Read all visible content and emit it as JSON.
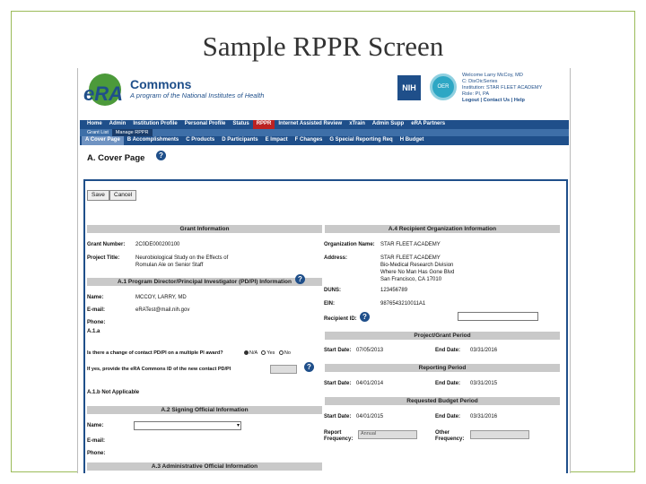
{
  "slide": {
    "title": "Sample RPPR Screen"
  },
  "header": {
    "logo_text": "eRA",
    "commons": "Commons",
    "program": "A program of the National Institutes of Health",
    "nih_logo": "NIH",
    "oer_logo": "OER",
    "user_lines": [
      "Welcome Larry McCoy, MD",
      "C: DisOicSeries",
      "Institution: STAR FLEET ACADEMY",
      "Role: PI, PA"
    ],
    "links": "Logout | Contact Us | Help"
  },
  "nav_main": [
    "Home",
    "Admin",
    "Institution Profile",
    "Personal Profile",
    "Status",
    "RPPR",
    "Internet Assisted Review",
    "xTrain",
    "Admin Supp",
    "eRA Partners"
  ],
  "nav_sub": [
    "Grant List",
    "Manage RPPR"
  ],
  "nav_sections": [
    "A Cover Page",
    "B Accomplishments",
    "C Products",
    "D Participants",
    "E Impact",
    "F Changes",
    "G Special Reporting Req",
    "H Budget"
  ],
  "page": {
    "title": "A. Cover Page"
  },
  "buttons": {
    "save": "Save",
    "cancel": "Cancel"
  },
  "grant_info": {
    "header": "Grant Information",
    "grant_number_label": "Grant Number:",
    "grant_number": "2C0DE000200100",
    "project_title_label": "Project Title:",
    "project_title_lines": [
      "Neurobiological Study on the Effects of",
      "Romulan Ale on Senior Staff"
    ]
  },
  "pd_pi": {
    "header": "A.1 Program Director/Principal Investigator (PD/PI) Information",
    "name_label": "Name:",
    "name": "MCCOY, LARRY, MD",
    "email_label": "E-mail:",
    "email": "eRATest@mail.nih.gov",
    "phone_label": "Phone:",
    "a1a_label": "A.1.a",
    "change_question": "Is there a change of contact PD/PI on a multiple PI award?",
    "radio_na": "N/A",
    "radio_yes": "Yes",
    "radio_no": "No",
    "commons_id_question": "If yes, provide the eRA Commons ID of the new contact PD/PI",
    "a1b": "A.1.b Not Applicable"
  },
  "signing": {
    "header": "A.2 Signing Official Information",
    "name_label": "Name:",
    "email_label": "E-mail:",
    "phone_label": "Phone:"
  },
  "admin_official": {
    "header": "A.3 Administrative Official Information"
  },
  "recipient": {
    "header": "A.4 Recipient Organization Information",
    "org_label": "Organization Name:",
    "org": "STAR FLEET ACADEMY",
    "address_label": "Address:",
    "address_lines": [
      "STAR FLEET ACADEMY",
      "Bio-Medical Research Division",
      "Where No Man Has Gone Blvd",
      "San Francisco, CA 17010"
    ],
    "duns_label": "DUNS:",
    "duns": "123456789",
    "ein_label": "EIN:",
    "ein": "9876543210011A1",
    "recipient_id_label": "Recipient ID:"
  },
  "project_period": {
    "header": "Project/Grant Period",
    "start_label": "Start Date:",
    "start": "07/05/2013",
    "end_label": "End Date:",
    "end": "03/31/2016"
  },
  "reporting_period": {
    "header": "Reporting Period",
    "start_label": "Start Date:",
    "start": "04/01/2014",
    "end_label": "End Date:",
    "end": "03/31/2015"
  },
  "budget_period": {
    "header": "Requested Budget Period",
    "start_label": "Start Date:",
    "start": "04/01/2015",
    "end_label": "End Date:",
    "end": "03/31/2016",
    "report_freq_label": "Report Frequency:",
    "report_freq_value": "Annual",
    "other_freq_label": "Other Frequency:"
  },
  "colors": {
    "nav": "#1f4f8a",
    "active_tab": "#bb2222",
    "section_bar": "#c9c9c9",
    "frame": "#9bbb59"
  }
}
